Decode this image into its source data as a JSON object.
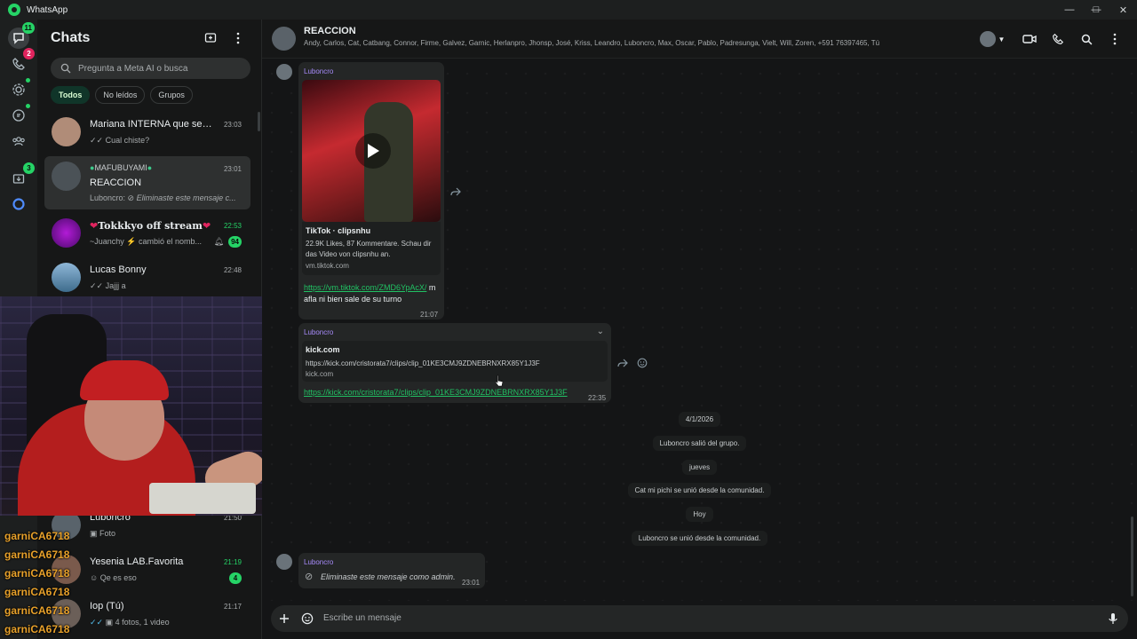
{
  "window": {
    "title": "WhatsApp",
    "controls": [
      "minimize",
      "maximize",
      "close"
    ]
  },
  "rail": {
    "items": [
      {
        "icon": "chats-icon",
        "badge": "11"
      },
      {
        "icon": "calls-icon",
        "badge": "2"
      },
      {
        "icon": "status-icon",
        "dot": true
      },
      {
        "icon": "channels-icon",
        "dot": true
      },
      {
        "icon": "communities-icon"
      },
      {
        "icon": "archive-icon",
        "badge": "3"
      },
      {
        "icon": "meta-ai-icon"
      }
    ]
  },
  "sidebar": {
    "title": "Chats",
    "search_placeholder": "Pregunta a Meta AI o busca",
    "filters": [
      "Todos",
      "No leídos",
      "Grupos"
    ],
    "active_filter": "Todos",
    "chats": [
      {
        "name": "Mariana INTERNA que se cre...",
        "time": "23:03",
        "preview": "Cual chiste?",
        "ticks": true
      },
      {
        "community": "MAFUBUYAMI",
        "name": "REACCION",
        "time": "23:01",
        "preview_sender": "Luboncro:",
        "preview": "Eliminaste este mensaje c...",
        "selected": true
      },
      {
        "name": "Tokkkyo off stream",
        "time": "22:53",
        "preview": "~Juanchy ⚡ cambió el nomb...",
        "unread": "94",
        "muted": true
      },
      {
        "name": "Lucas Bonny",
        "time": "22:48",
        "preview": "Jajjj a",
        "ticks": true
      },
      {
        "name": "Luboncro",
        "time": "21:50",
        "preview": "Foto"
      },
      {
        "name": "Yesenia LAB.Favorita",
        "time": "21:19",
        "preview": "Qe es eso",
        "unread": "4"
      },
      {
        "name": "Iop (Tú)",
        "time": "21:17",
        "preview": "4 fotos, 1 video",
        "ticks": true
      }
    ]
  },
  "stream_overlay": {
    "chat_usernames": [
      "garniCA6718",
      "garniCA6718",
      "garniCA6718",
      "garniCA6718",
      "garniCA6718",
      "garniCA6718"
    ]
  },
  "conversation": {
    "title": "REACCION",
    "members": "Andy, Carlos, Cat, Catbang, Connor, Firme, Galvez, Garnic, Herlanpro, Jhonsp, José, Kriss, Leandro, Luboncro, Max, Oscar, Pablo, Padresunga, Vielt, Will, Zoren, +591 76397465, Tú",
    "messages": [
      {
        "sender": "Luboncro",
        "preview_title": "TikTok · clipsnhu",
        "preview_desc": "22.9K Likes, 87 Kommentare. Schau dir das Video von clipsnhu an.",
        "preview_host": "vm.tiktok.com",
        "link": "https://vm.tiktok.com/ZMD6YpAcX/",
        "text": "mafla ni bien sale de su turno",
        "time": "21:07"
      },
      {
        "sender": "Luboncro",
        "preview_title": "kick.com",
        "preview_desc": "https://kick.com/cristorata7/clips/clip_01KE3CMJ9ZDNEBRNXRX85Y1J3F",
        "preview_host": "kick.com",
        "link": "https://kick.com/cristorata7/clips/clip_01KE3CMJ9ZDNEBRNXRX85Y1J3F",
        "time": "22:35"
      }
    ],
    "system": [
      "4/1/2026",
      "Luboncro salió del grupo.",
      "jueves",
      "Cat mi pichi se unió desde la comunidad.",
      "Hoy",
      "Luboncro se unió desde la comunidad."
    ],
    "deleted": {
      "sender": "Luboncro",
      "text": "Eliminaste este mensaje como admin.",
      "time": "23:01"
    },
    "composer_placeholder": "Escribe un mensaje"
  }
}
